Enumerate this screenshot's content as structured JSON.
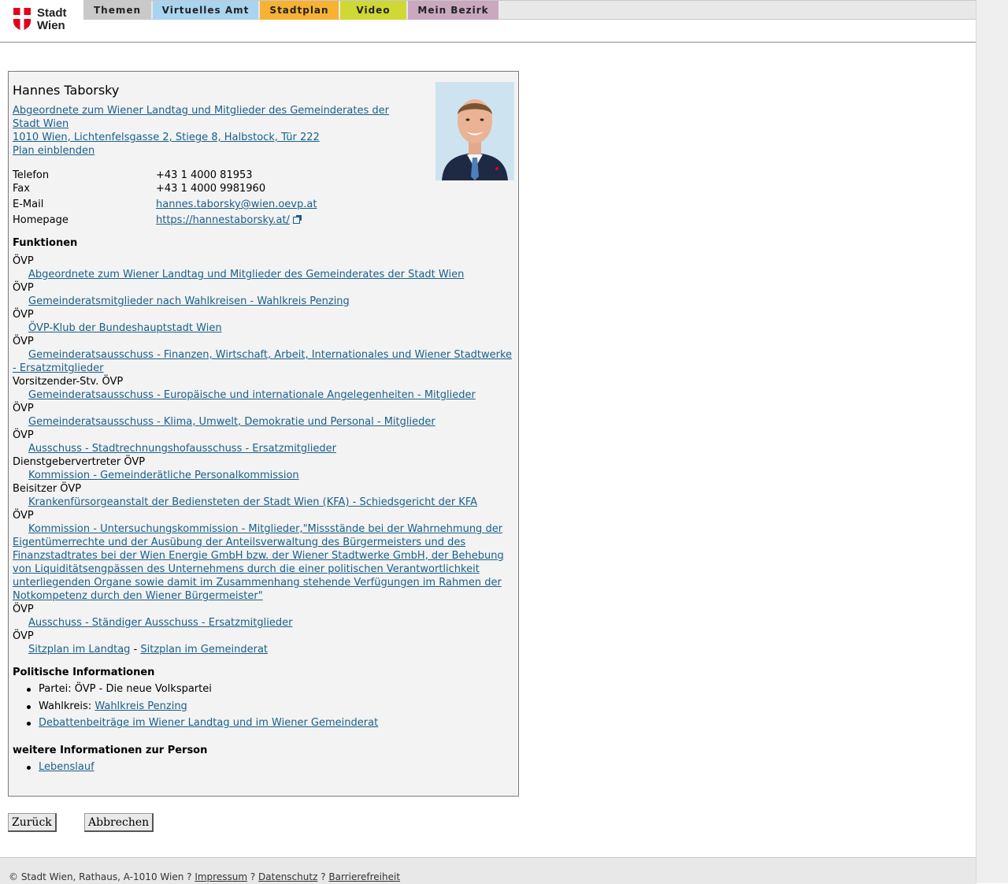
{
  "header": {
    "logo_line1": "Stadt",
    "logo_line2": "Wien",
    "tabs": [
      "Themen",
      "Virtuelles Amt",
      "Stadtplan",
      "Video",
      "Mein Bezirk"
    ]
  },
  "person": {
    "name": "Hannes Taborsky",
    "org_link_line1": "Abgeordnete zum Wiener Landtag und Mitglieder des Gemeinderates der",
    "org_link_line2": "Stadt Wien ",
    "address": "1010 Wien, Lichtenfelsgasse 2, Stiege 8, Halbstock, Tür 222",
    "plan_link": "Plan einblenden"
  },
  "contact": [
    {
      "label": "Telefon",
      "value": "+43 1 4000 81953"
    },
    {
      "label": "Fax",
      "value": "+43 1 4000 9981960"
    },
    {
      "label": "E-Mail",
      "value": "hannes.taborsky@wien.oevp.at"
    },
    {
      "label": "Homepage",
      "value": "https://hannestaborsky.at/"
    }
  ],
  "funktionen": {
    "heading": "Funktionen",
    "items": [
      {
        "role": "ÖVP",
        "link": "Abgeordnete zum Wiener Landtag und Mitglieder des Gemeinderates der Stadt Wien"
      },
      {
        "role": "ÖVP",
        "link": "Gemeinderatsmitglieder nach Wahlkreisen - Wahlkreis Penzing"
      },
      {
        "role": "ÖVP",
        "link": "ÖVP-Klub der Bundeshauptstadt Wien"
      },
      {
        "role": "ÖVP",
        "link": "Gemeinderatsausschuss - Finanzen, Wirtschaft, Arbeit, Internationales und Wiener Stadtwerke - Ersatzmitglieder"
      },
      {
        "role": "Vorsitzender-Stv. ÖVP",
        "link": "Gemeinderatsausschuss - Europäische und internationale Angelegenheiten - Mitglieder"
      },
      {
        "role": "ÖVP",
        "link": "Gemeinderatsausschuss - Klima, Umwelt, Demokratie und Personal - Mitglieder"
      },
      {
        "role": "ÖVP",
        "link": "Ausschuss - Stadtrechnungshofausschuss - Ersatzmitglieder"
      },
      {
        "role": "Dienstgebervertreter ÖVP",
        "link": "Kommission - Gemeinderätliche Personalkommission"
      },
      {
        "role": "Beisitzer ÖVP",
        "link": "Krankenfürsorgeanstalt der Bediensteten der Stadt Wien (KFA) - Schiedsgericht der KFA"
      },
      {
        "role": "ÖVP",
        "link": "Kommission - Untersuchungskommission - Mitglieder,\"Missstände bei der Wahrnehmung der Eigentümerrechte und der Ausübung der Anteilsverwaltung des Bürgermeisters und des Finanzstadtrates bei der Wien Energie GmbH bzw. der Wiener Stadtwerke GmbH, der Behebung von Liquiditätsengpässen des Unternehmens durch die einer politischen Verantwortlichkeit unterliegenden Organe sowie damit im Zusammenhang stehende Verfügungen im Rahmen der Notkompetenz durch den Wiener Bürgermeister\""
      },
      {
        "role": "ÖVP",
        "link": "Ausschuss - Ständiger Ausschuss - Ersatzmitglieder"
      },
      {
        "role": "ÖVP",
        "link": "Sitzplan im Landtag"
      }
    ],
    "separator": " - ",
    "extra_link": "Sitzplan im Gemeinderat"
  },
  "politisch": {
    "heading": "Politische Informationen",
    "partei": "Partei: ÖVP - Die neue Volkspartei",
    "wahlkreis_label": "Wahlkreis: ",
    "wahlkreis_link": "Wahlkreis Penzing",
    "debatten_link": "Debattenbeiträge im Wiener Landtag und im Wiener Gemeinderat"
  },
  "weitere": {
    "heading": "weitere Informationen zur Person",
    "lebenslauf": "Lebenslauf"
  },
  "buttons": {
    "back": "Zurück",
    "cancel": "Abbrechen"
  },
  "footer": {
    "copyright": "© Stadt Wien, Rathaus, A-1010 Wien ? ",
    "impressum": "Impressum",
    "sep": " ? ",
    "datenschutz": "Datenschutz",
    "barriere": "Barrierefreiheit"
  },
  "colors": {
    "link": "#1a5f8a",
    "card_bg": "#f3f3f3",
    "logo_red": "#e2001a"
  }
}
